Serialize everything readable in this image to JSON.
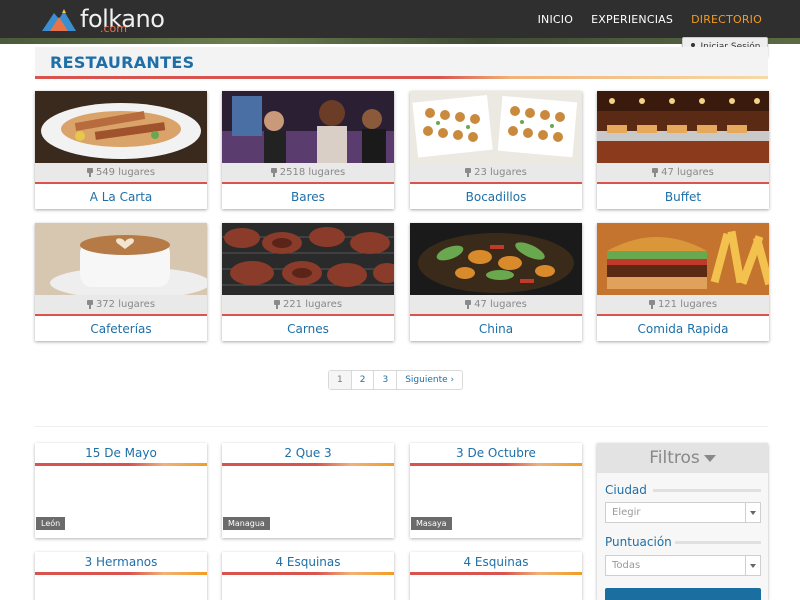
{
  "header": {
    "logo_text": "folkano",
    "logo_sub": ".com",
    "nav": [
      {
        "label": "INICIO"
      },
      {
        "label": "EXPERIENCIAS"
      },
      {
        "label": "DIRECTORIO"
      }
    ],
    "login_label": "Iniciar Sesión"
  },
  "section": {
    "title": "RESTAURANTES"
  },
  "categories": [
    {
      "name": "A La Carta",
      "count": "549 lugares"
    },
    {
      "name": "Bares",
      "count": "2518 lugares"
    },
    {
      "name": "Bocadillos",
      "count": "23 lugares"
    },
    {
      "name": "Buffet",
      "count": "47 lugares"
    },
    {
      "name": "Cafeterías",
      "count": "372 lugares"
    },
    {
      "name": "Carnes",
      "count": "221 lugares"
    },
    {
      "name": "China",
      "count": "47 lugares"
    },
    {
      "name": "Comida Rapida",
      "count": "121 lugares"
    }
  ],
  "pagination": {
    "pages": [
      "1",
      "2",
      "3"
    ],
    "next": "Siguiente ›",
    "current": "1"
  },
  "places": [
    {
      "name": "15 De Mayo",
      "city": "León"
    },
    {
      "name": "2 Que 3",
      "city": "Managua"
    },
    {
      "name": "3 De Octubre",
      "city": "Masaya"
    },
    {
      "name": "3 Hermanos",
      "city": ""
    },
    {
      "name": "4 Esquinas",
      "city": ""
    },
    {
      "name": "4 Esquinas",
      "city": ""
    }
  ],
  "filters": {
    "title": "Filtros",
    "city_label": "Ciudad",
    "city_value": "Elegir",
    "rating_label": "Puntuación",
    "rating_value": "Todas"
  },
  "colors": {
    "accent_blue": "#1e6fa8",
    "accent_red": "#d9534f",
    "nav_active": "#f39c1f",
    "topbar": "#2f2f2f"
  }
}
